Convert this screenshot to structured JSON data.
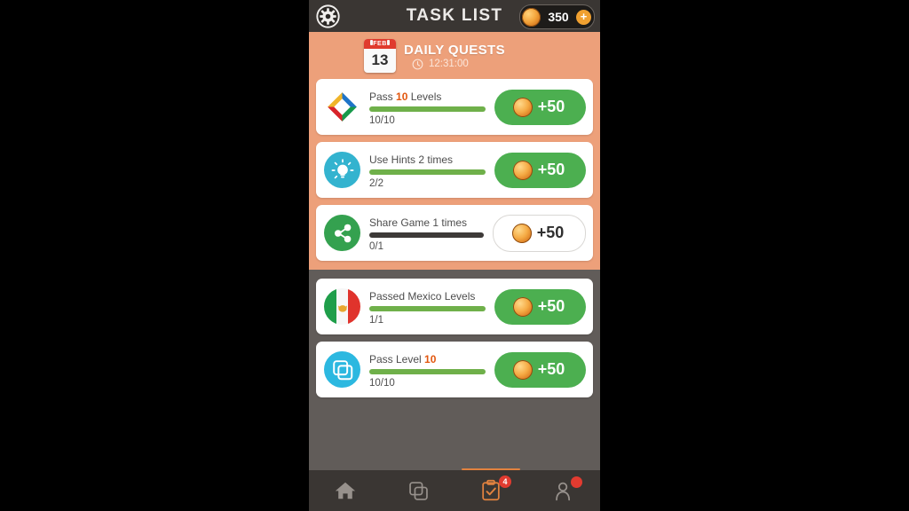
{
  "header": {
    "title": "TASK LIST",
    "settings_icon": "gear-icon",
    "coin_icon": "coin-icon",
    "coin_count": "350",
    "add_coins_label": "+"
  },
  "daily": {
    "calendar_month": "FEB",
    "calendar_day": "13",
    "title": "DAILY QUESTS",
    "clock_icon": "clock-icon",
    "timer": "12:31:00",
    "tasks": [
      {
        "icon": "diamond-pinwheel-icon",
        "title_pre": "Pass ",
        "title_highlight": "10",
        "title_post": " Levels",
        "progress_text": "10/10",
        "progress_percent": 100,
        "complete": true,
        "reward": "+50",
        "reward_icon": "coin-icon"
      },
      {
        "icon": "lightbulb-icon",
        "title_pre": "Use Hints 2 times",
        "title_highlight": "",
        "title_post": "",
        "progress_text": "2/2",
        "progress_percent": 100,
        "complete": true,
        "reward": "+50",
        "reward_icon": "coin-icon"
      },
      {
        "icon": "share-icon",
        "title_pre": "Share Game 1 times",
        "title_highlight": "",
        "title_post": "",
        "progress_text": "0/1",
        "progress_percent": 0,
        "complete": false,
        "reward": "+50",
        "reward_icon": "coin-icon"
      }
    ]
  },
  "other": {
    "tasks": [
      {
        "icon": "mexico-flag-icon",
        "title_pre": "Passed Mexico Levels",
        "title_highlight": "",
        "title_post": "",
        "progress_text": "1/1",
        "progress_percent": 100,
        "complete": true,
        "reward": "+50",
        "reward_icon": "coin-icon"
      },
      {
        "icon": "layers-icon",
        "title_pre": "Pass Level ",
        "title_highlight": "10",
        "title_post": "",
        "progress_text": "10/10",
        "progress_percent": 100,
        "complete": true,
        "reward": "+50",
        "reward_icon": "coin-icon"
      }
    ]
  },
  "navbar": {
    "items": [
      {
        "icon": "home-icon",
        "active": false,
        "badge": ""
      },
      {
        "icon": "layers-icon",
        "active": false,
        "badge": ""
      },
      {
        "icon": "tasks-clipboard-icon",
        "active": true,
        "badge": "4"
      },
      {
        "icon": "profile-icon",
        "active": false,
        "badge": ""
      }
    ]
  },
  "colors": {
    "top_bar": "#3a3633",
    "daily_section": "#eda07a",
    "page_background": "#615c59",
    "accent_orange": "#e2570f",
    "reward_green": "#4caf50",
    "progress_green": "#6fb04a",
    "badge_red": "#e23b30"
  }
}
